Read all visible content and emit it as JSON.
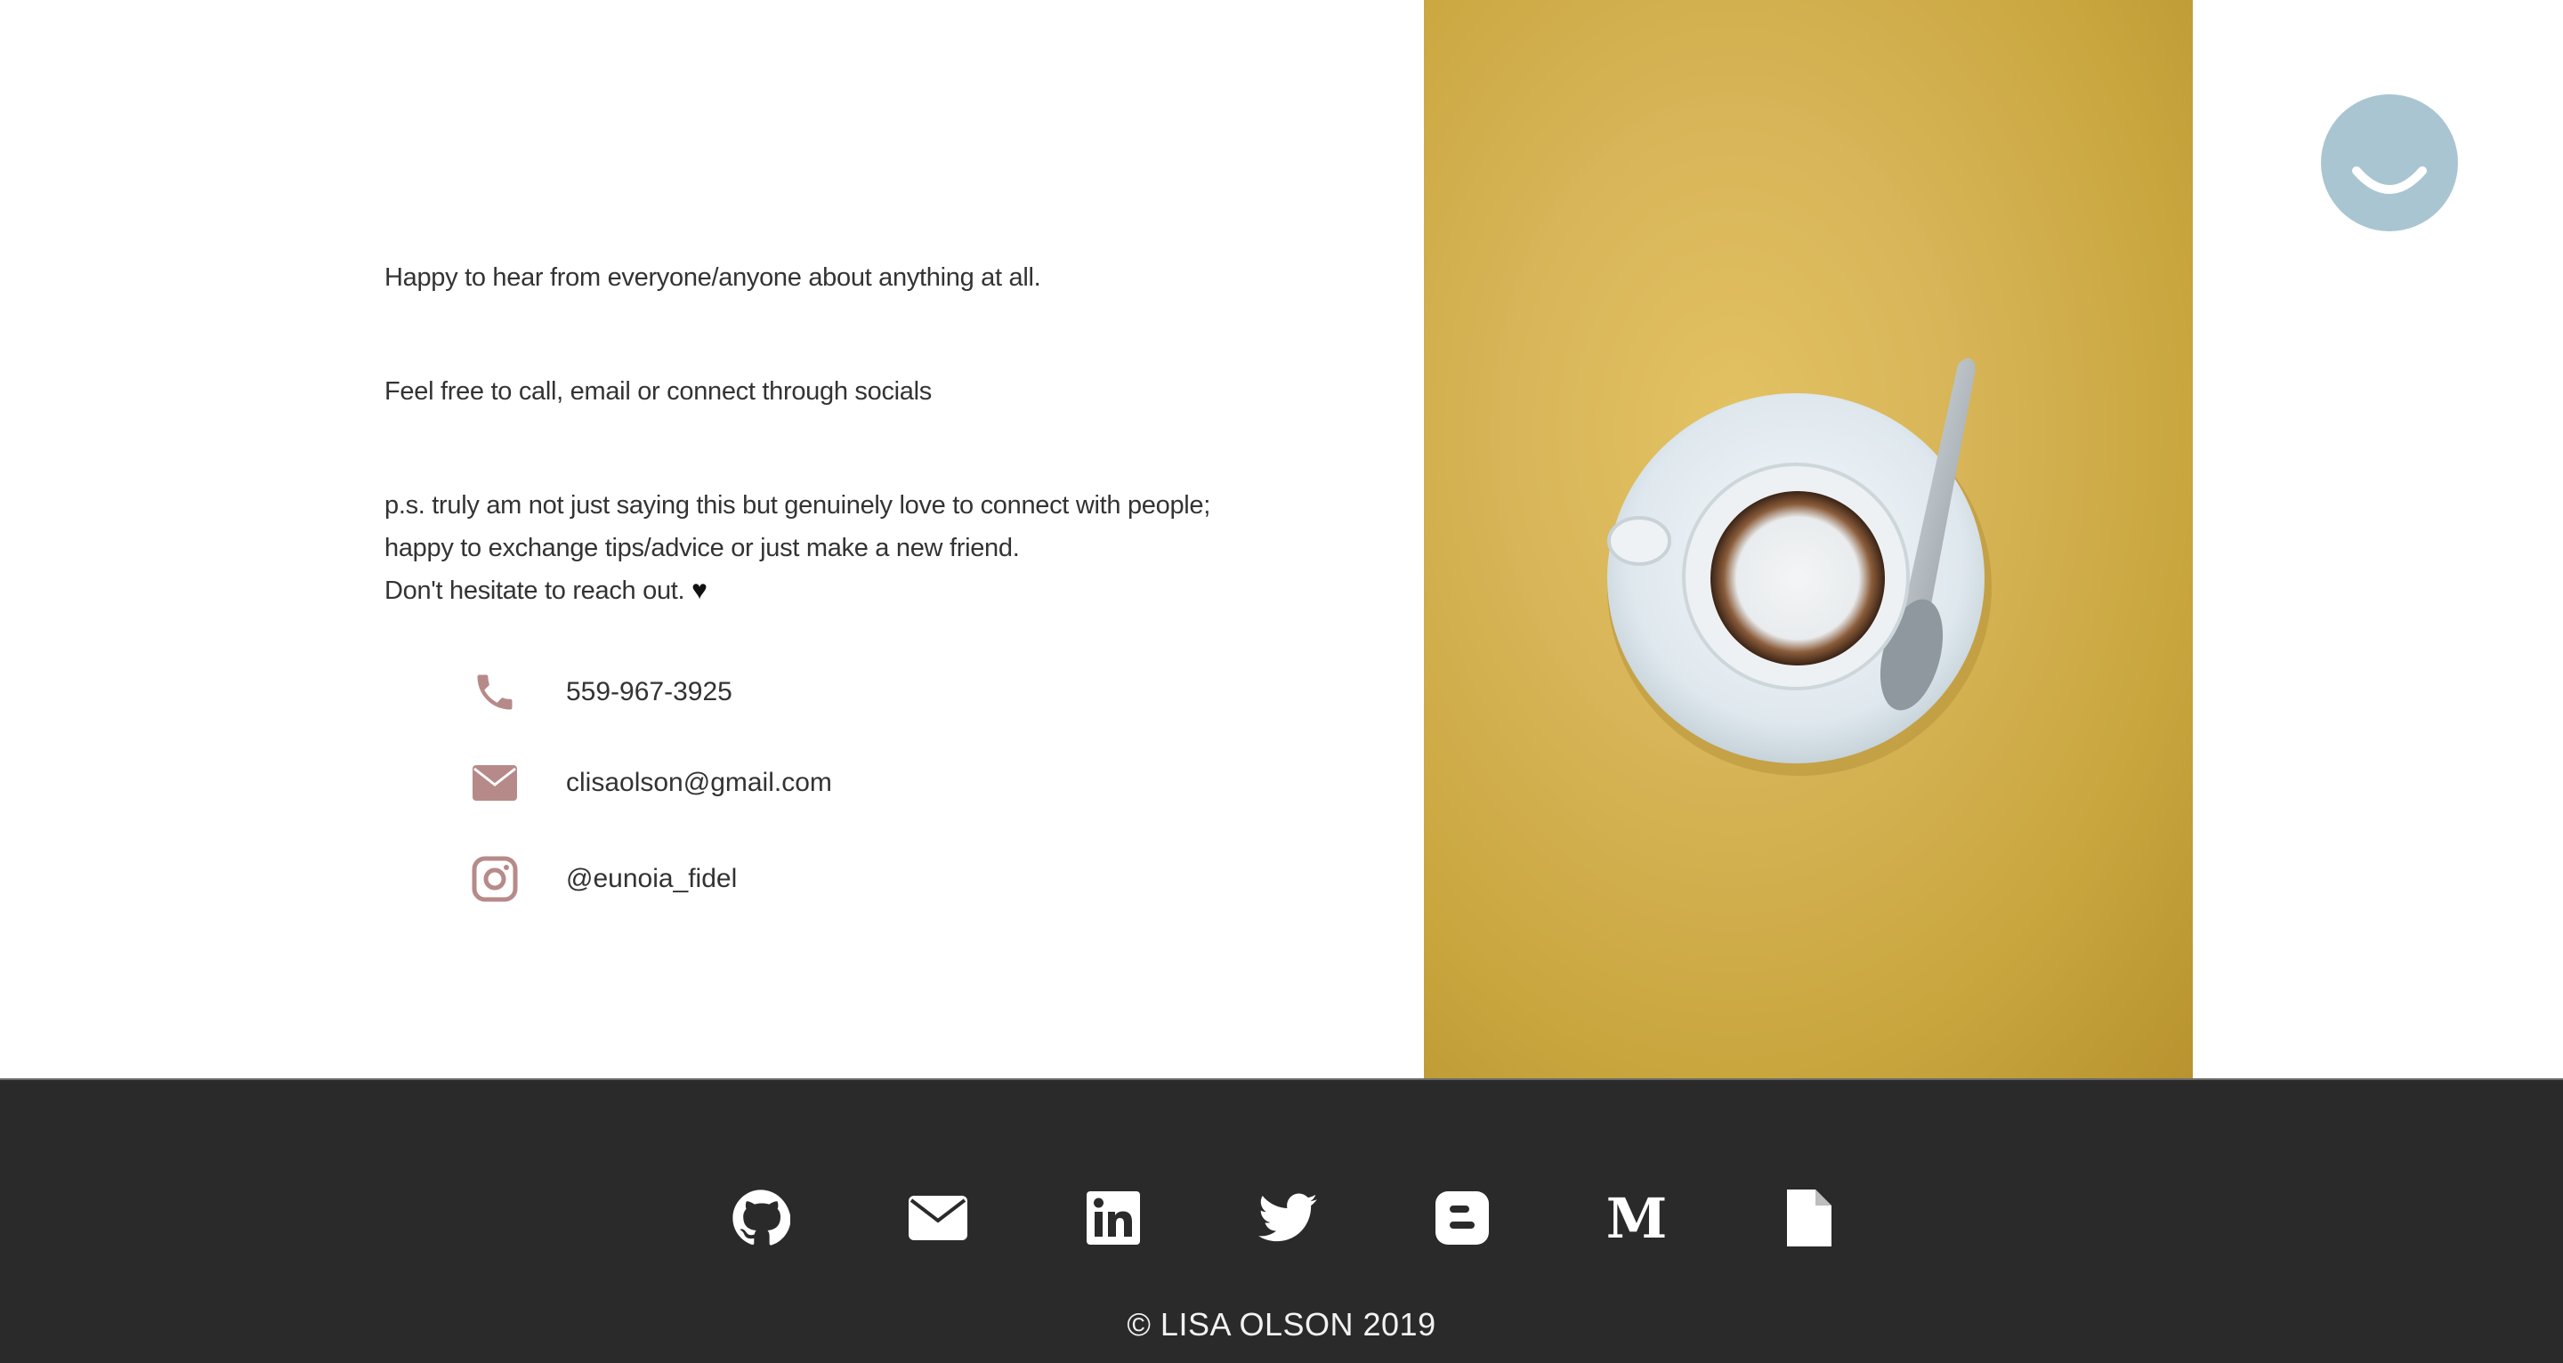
{
  "intro": {
    "line1": "Happy to hear from everyone/anyone about anything at all.",
    "line2": "Feel free to call, email or connect through socials",
    "line3a": "p.s. truly am not just saying this but genuinely love to connect with people;",
    "line3b": "happy to exchange tips/advice or just make a new friend.",
    "line3c": "Don't hesitate to reach out.",
    "heart": "♥"
  },
  "contact": {
    "phone": "559-967-3925",
    "email": "clisaolson@gmail.com",
    "instagram": "@eunoia_fidel"
  },
  "icons": {
    "phone": "phone-icon",
    "email": "envelope-icon",
    "instagram": "instagram-icon",
    "accent_color": "#b78a8a"
  },
  "footer": {
    "social": [
      "github-icon",
      "envelope-icon",
      "linkedin-icon",
      "twitter-icon",
      "blogger-icon",
      "medium-icon",
      "document-icon"
    ],
    "copyright": "© LISA OLSON 2019",
    "background": "#2a2a2a"
  }
}
